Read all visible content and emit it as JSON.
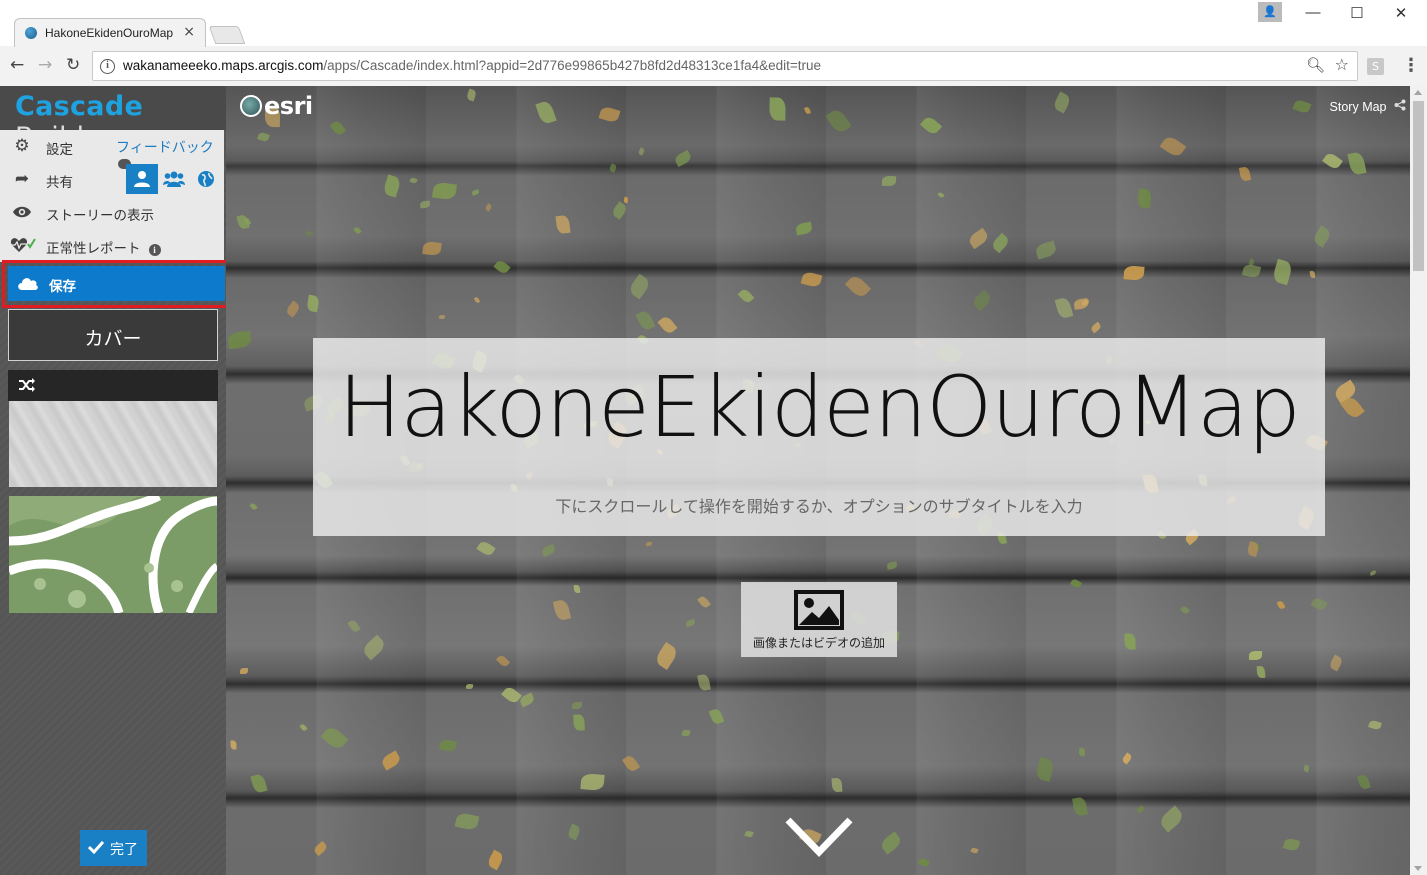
{
  "browser": {
    "tab_title": "HakoneEkidenOuroMap",
    "tab_close": "×",
    "url_host": "wakanameeeko.maps.arcgis.com",
    "url_path": "/apps/Cascade/index.html?appid=2d776e99865b427b8fd2d48313ce1fa4&edit=true",
    "window_minimize": "—",
    "window_maximize": "☐",
    "window_close": "✕",
    "extension_label": "S"
  },
  "builder": {
    "brand_accent": "Cascade",
    "brand_rest": " Builder",
    "menu": {
      "settings": "設定",
      "feedback": "フィードバック",
      "share": "共有",
      "view_story": "ストーリーの表示",
      "health_report": "正常性レポート",
      "save": "保存"
    },
    "cards": {
      "cover": "カバー"
    },
    "done": "完了"
  },
  "story": {
    "brand": "esri",
    "storymap_label": "Story Map",
    "title": "HakoneEkidenOuroMap",
    "subtitle": "下にスクロールして操作を開始するか、オプションのサブタイトルを入力",
    "add_media": "画像またはビデオの追加"
  },
  "colors": {
    "accent_blue": "#0d7acb",
    "highlight_red": "#e21b23",
    "brand_cyan": "#1fa3e0"
  }
}
